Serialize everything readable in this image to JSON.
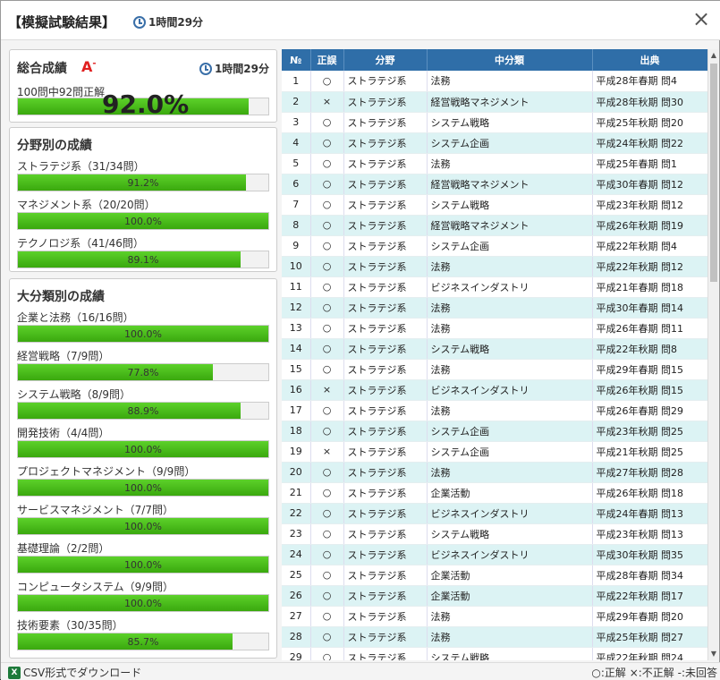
{
  "header": {
    "title": "【模擬試験結果】",
    "time": "1時間29分",
    "close": "×"
  },
  "overall": {
    "title": "総合成績",
    "grade": "A",
    "grade_sup": "-",
    "time": "1時間29分",
    "summary": "100問中92問正解",
    "percent_text": "92.0%",
    "percent": 92.0
  },
  "fields": {
    "title": "分野別の成績",
    "items": [
      {
        "label": "ストラテジ系（31/34問）",
        "pct_text": "91.2%",
        "pct": 91.2
      },
      {
        "label": "マネジメント系（20/20問）",
        "pct_text": "100.0%",
        "pct": 100.0
      },
      {
        "label": "テクノロジ系（41/46問）",
        "pct_text": "89.1%",
        "pct": 89.1
      }
    ]
  },
  "categories": {
    "title": "大分類別の成績",
    "items": [
      {
        "label": "企業と法務（16/16問）",
        "pct_text": "100.0%",
        "pct": 100.0
      },
      {
        "label": "経営戦略（7/9問）",
        "pct_text": "77.8%",
        "pct": 77.8
      },
      {
        "label": "システム戦略（8/9問）",
        "pct_text": "88.9%",
        "pct": 88.9
      },
      {
        "label": "開発技術（4/4問）",
        "pct_text": "100.0%",
        "pct": 100.0
      },
      {
        "label": "プロジェクトマネジメント（9/9問）",
        "pct_text": "100.0%",
        "pct": 100.0
      },
      {
        "label": "サービスマネジメント（7/7問）",
        "pct_text": "100.0%",
        "pct": 100.0
      },
      {
        "label": "基礎理論（2/2問）",
        "pct_text": "100.0%",
        "pct": 100.0
      },
      {
        "label": "コンピュータシステム（9/9問）",
        "pct_text": "100.0%",
        "pct": 100.0
      },
      {
        "label": "技術要素（30/35問）",
        "pct_text": "85.7%",
        "pct": 85.7
      }
    ]
  },
  "table": {
    "headers": [
      "№",
      "正誤",
      "分野",
      "中分類",
      "出典"
    ],
    "rows": [
      [
        "1",
        "○",
        "ストラテジ系",
        "法務",
        "平成28年春期 問4"
      ],
      [
        "2",
        "×",
        "ストラテジ系",
        "経営戦略マネジメント",
        "平成28年秋期 問30"
      ],
      [
        "3",
        "○",
        "ストラテジ系",
        "システム戦略",
        "平成25年秋期 問20"
      ],
      [
        "4",
        "○",
        "ストラテジ系",
        "システム企画",
        "平成24年秋期 問22"
      ],
      [
        "5",
        "○",
        "ストラテジ系",
        "法務",
        "平成25年春期 問1"
      ],
      [
        "6",
        "○",
        "ストラテジ系",
        "経営戦略マネジメント",
        "平成30年春期 問12"
      ],
      [
        "7",
        "○",
        "ストラテジ系",
        "システム戦略",
        "平成23年秋期 問12"
      ],
      [
        "8",
        "○",
        "ストラテジ系",
        "経営戦略マネジメント",
        "平成26年秋期 問19"
      ],
      [
        "9",
        "○",
        "ストラテジ系",
        "システム企画",
        "平成22年秋期 問4"
      ],
      [
        "10",
        "○",
        "ストラテジ系",
        "法務",
        "平成22年秋期 問12"
      ],
      [
        "11",
        "○",
        "ストラテジ系",
        "ビジネスインダストリ",
        "平成21年春期 問18"
      ],
      [
        "12",
        "○",
        "ストラテジ系",
        "法務",
        "平成30年春期 問14"
      ],
      [
        "13",
        "○",
        "ストラテジ系",
        "法務",
        "平成26年春期 問11"
      ],
      [
        "14",
        "○",
        "ストラテジ系",
        "システム戦略",
        "平成22年秋期 問8"
      ],
      [
        "15",
        "○",
        "ストラテジ系",
        "法務",
        "平成29年春期 問15"
      ],
      [
        "16",
        "×",
        "ストラテジ系",
        "ビジネスインダストリ",
        "平成26年秋期 問15"
      ],
      [
        "17",
        "○",
        "ストラテジ系",
        "法務",
        "平成26年春期 問29"
      ],
      [
        "18",
        "○",
        "ストラテジ系",
        "システム企画",
        "平成23年秋期 問25"
      ],
      [
        "19",
        "×",
        "ストラテジ系",
        "システム企画",
        "平成21年秋期 問25"
      ],
      [
        "20",
        "○",
        "ストラテジ系",
        "法務",
        "平成27年秋期 問28"
      ],
      [
        "21",
        "○",
        "ストラテジ系",
        "企業活動",
        "平成26年秋期 問18"
      ],
      [
        "22",
        "○",
        "ストラテジ系",
        "ビジネスインダストリ",
        "平成24年春期 問13"
      ],
      [
        "23",
        "○",
        "ストラテジ系",
        "システム戦略",
        "平成23年秋期 問13"
      ],
      [
        "24",
        "○",
        "ストラテジ系",
        "ビジネスインダストリ",
        "平成30年秋期 問35"
      ],
      [
        "25",
        "○",
        "ストラテジ系",
        "企業活動",
        "平成28年春期 問34"
      ],
      [
        "26",
        "○",
        "ストラテジ系",
        "企業活動",
        "平成22年秋期 問17"
      ],
      [
        "27",
        "○",
        "ストラテジ系",
        "法務",
        "平成29年春期 問20"
      ],
      [
        "28",
        "○",
        "ストラテジ系",
        "法務",
        "平成25年秋期 問27"
      ],
      [
        "29",
        "○",
        "ストラテジ系",
        "システム戦略",
        "平成22年秋期 問24"
      ]
    ]
  },
  "footer": {
    "csv_icon": "X",
    "csv_label": "CSV形式でダウンロード",
    "legend": "○:正解 ×:不正解 -:未回答"
  }
}
